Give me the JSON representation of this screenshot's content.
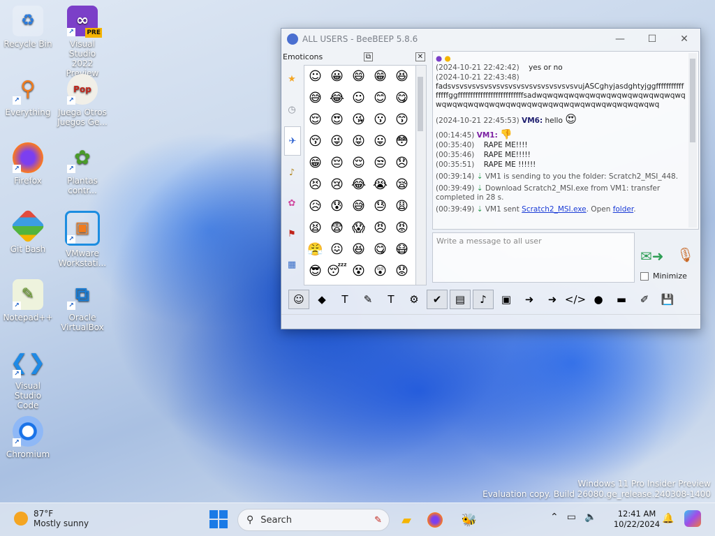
{
  "desktop_icons": [
    {
      "label": "Recycle Bin",
      "icon": "recycle-bin-icon"
    },
    {
      "label": "Visual Studio 2022 Preview",
      "icon": "visual-studio-preview-icon",
      "badge": "PRE"
    },
    {
      "label": "Everything",
      "icon": "everything-search-icon"
    },
    {
      "label": "Juega Otros Juegos Ge...",
      "icon": "popcap-games-icon"
    },
    {
      "label": "Firefox",
      "icon": "firefox-icon"
    },
    {
      "label": "Plantas contr...",
      "icon": "plants-vs-zombies-icon"
    },
    {
      "label": "Git Bash",
      "icon": "git-bash-icon"
    },
    {
      "label": "VMware Workstati...",
      "icon": "vmware-icon"
    },
    {
      "label": "Notepad++",
      "icon": "notepad-plus-plus-icon"
    },
    {
      "label": "Oracle VirtualBox",
      "icon": "virtualbox-icon"
    },
    {
      "label": "Visual Studio Code",
      "icon": "vscode-icon"
    },
    {
      "label": "Chromium",
      "icon": "chromium-icon"
    }
  ],
  "window": {
    "title": "ALL USERS - BeeBEEP 5.8.6",
    "controls": {
      "minimize": "—",
      "maximize": "☐",
      "close": "✕"
    }
  },
  "emoticons": {
    "header": "Emoticons",
    "tabs": [
      "★",
      "◷",
      "✈",
      "♪",
      "✿",
      "⚑",
      "▦"
    ],
    "grid": [
      "☺",
      "😀",
      "😄",
      "😁",
      "😆",
      "😅",
      "😂",
      "☺",
      "😊",
      "😋",
      "😌",
      "😍",
      "😘",
      "😗",
      "😙",
      "😚",
      "😜",
      "😝",
      "😛",
      "😳",
      "😁",
      "😔",
      "😌",
      "😒",
      "😞",
      "😣",
      "😢",
      "😂",
      "😭",
      "😪",
      "😥",
      "😰",
      "😅",
      "😓",
      "😩",
      "😫",
      "😨",
      "😱",
      "😠",
      "😡",
      "😤",
      "😖",
      "😆",
      "😋",
      "😷",
      "😎",
      "😴",
      "😵",
      "😲",
      "😟",
      "😦",
      "😧",
      "😈",
      "👿",
      "😮",
      "😬",
      "😐",
      "😕",
      "😯",
      "😶"
    ]
  },
  "chat": {
    "messages": [
      {
        "ts": "(2024-10-21 22:42:42)",
        "text": "yes or no"
      },
      {
        "ts": "(2024-10-21 22:43:48)",
        "text": "fadsvsvsvsvsvsvsvsvsvsvsvsvsvsvsvsvujASCghyjasdghtyjggffffffffffffffffggffffffffffffffffffffffffffsadwqwqwqwqwqwqwqwqwqwqwqwqwqwqwqwqwqwqwqwqwqwqwqwqwqwqwqwqwqwqwqwqwqwqwq"
      },
      {
        "ts": "(2024-10-21 22:45:53)",
        "nick": "VM6:",
        "text": "hello",
        "emoji": "😍"
      },
      {
        "ts": "(00:14:45)",
        "nick": "VM1:",
        "emoji": "👎"
      },
      {
        "ts": "(00:35:40)",
        "text": "RAPE ME!!!!"
      },
      {
        "ts": "(00:35:46)",
        "text": "RAPE ME!!!!!"
      },
      {
        "ts": "(00:35:51)",
        "text": "RAPE ME !!!!!!"
      },
      {
        "ts": "(00:39:14)",
        "text": "VM1 is sending to you the folder: Scratch2_MSI_448."
      },
      {
        "ts": "(00:39:49)",
        "text": "Download Scratch2_MSI.exe from VM1: transfer completed in 28 s."
      },
      {
        "ts": "(00:39:49)",
        "text_pre": "VM1 sent ",
        "link1": "Scratch2_MSI.exe",
        "text_mid": ". Open ",
        "link2": "folder",
        "text_post": "."
      }
    ]
  },
  "compose": {
    "placeholder": "Write a message to all user",
    "minimize_label": "Minimize"
  },
  "toolbar": {
    "buttons": [
      {
        "icon": "emoticon-icon",
        "glyph": "☺",
        "pressed": true
      },
      {
        "icon": "bee-icon",
        "glyph": "◆"
      },
      {
        "icon": "font-icon",
        "glyph": "T"
      },
      {
        "icon": "color-pen-icon",
        "glyph": "✎"
      },
      {
        "icon": "format-icon",
        "glyph": "T"
      },
      {
        "icon": "settings-gear-icon",
        "glyph": "⚙"
      },
      {
        "icon": "checklist-icon",
        "glyph": "✔",
        "pressed": true
      },
      {
        "icon": "chart-icon",
        "glyph": "▤",
        "pressed": true
      },
      {
        "icon": "music-note-icon",
        "glyph": "♪",
        "pressed": true
      },
      {
        "icon": "document-icon",
        "glyph": "▣"
      },
      {
        "icon": "send-file-icon",
        "glyph": "➜"
      },
      {
        "icon": "send-folder-icon",
        "glyph": "➜"
      },
      {
        "icon": "code-icon",
        "glyph": "</>"
      },
      {
        "icon": "record-icon",
        "glyph": "●"
      },
      {
        "icon": "clapper-icon",
        "glyph": "▬"
      },
      {
        "icon": "notes-icon",
        "glyph": "✐"
      },
      {
        "icon": "save-icon",
        "glyph": "💾"
      }
    ]
  },
  "watermark": {
    "line1": "Windows 11 Pro Insider Preview",
    "line2": "Evaluation copy. Build 26080.ge_release.240308-1400"
  },
  "taskbar": {
    "weather_temp": "87°F",
    "weather_desc": "Mostly sunny",
    "search_label": "Search",
    "time": "12:41 AM",
    "date": "10/22/2024"
  }
}
